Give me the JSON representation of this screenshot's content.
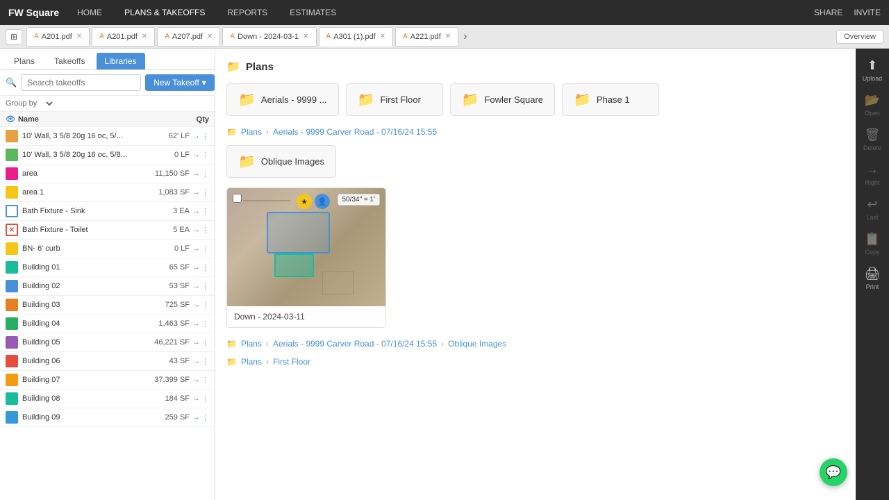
{
  "app": {
    "logo": "FW Square",
    "nav": [
      "HOME",
      "PLANS & TAKEOFFS",
      "REPORTS",
      "ESTIMATES"
    ],
    "active_nav": "PLANS & TAKEOFFS",
    "top_right": [
      "SHARE",
      "INVITE"
    ]
  },
  "tabs": [
    {
      "id": 1,
      "label": "A201.pdf",
      "closable": true
    },
    {
      "id": 2,
      "label": "A201.pdf",
      "closable": true
    },
    {
      "id": 3,
      "label": "A207.pdf",
      "closable": true
    },
    {
      "id": 4,
      "label": "Down - 2024-03-1",
      "closable": true
    },
    {
      "id": 5,
      "label": "A301 (1).pdf",
      "closable": true,
      "active": true
    },
    {
      "id": 6,
      "label": "A221.pdf",
      "closable": true
    }
  ],
  "tab_more": "›",
  "overview_label": "Overview",
  "sidebar": {
    "tabs": [
      "Plans",
      "Takeoffs",
      "Libraries"
    ],
    "active_tab": "Libraries",
    "search_placeholder": "Search takeoffs",
    "new_takeoff_label": "New Takeoff",
    "groupby_label": "Group by",
    "list_header": {
      "name": "Name",
      "qty": "Qty"
    },
    "items": [
      {
        "name": "10' Wall, 3 5/8 20g 16 oc, 5/...",
        "qty": "62' LF",
        "icon_color": "orange"
      },
      {
        "name": "10' Wall, 3 5/8 20g 16 oc, 5/8...",
        "qty": "0 LF",
        "icon_color": "green"
      },
      {
        "name": "area",
        "qty": "11,150 SF",
        "icon_color": "pink"
      },
      {
        "name": "area 1",
        "qty": "1,083 SF",
        "icon_color": "yellow"
      },
      {
        "name": "Bath Fixture - Sink",
        "qty": "3 EA",
        "icon_color": "blue_outline"
      },
      {
        "name": "Bath Fixture - Toilet",
        "qty": "5 EA",
        "icon_color": "red_x"
      },
      {
        "name": "BN- 6' curb",
        "qty": "0 LF",
        "icon_color": "yellow"
      },
      {
        "name": "Building 01",
        "qty": "65 SF",
        "icon_color": "teal"
      },
      {
        "name": "Building 02",
        "qty": "53 SF",
        "icon_color": "blue"
      },
      {
        "name": "Building 03",
        "qty": "725 SF",
        "icon_color": "orange2"
      },
      {
        "name": "Building 04",
        "qty": "1,463 SF",
        "icon_color": "green2"
      },
      {
        "name": "Building 05",
        "qty": "46,221 SF",
        "icon_color": "multi"
      },
      {
        "name": "Building 06",
        "qty": "43 SF",
        "icon_color": "multi2"
      },
      {
        "name": "Building 07",
        "qty": "37,399 SF",
        "icon_color": "multi3"
      },
      {
        "name": "Building 08",
        "qty": "184 SF",
        "icon_color": "multi4"
      },
      {
        "name": "Building 09",
        "qty": "259 SF",
        "icon_color": "multi5"
      }
    ]
  },
  "right_sidebar": {
    "buttons": [
      {
        "id": "upload",
        "label": "Upload",
        "icon": "⬆"
      },
      {
        "id": "open",
        "label": "Open",
        "icon": "📂"
      },
      {
        "id": "delete",
        "label": "Delete",
        "icon": "🗑"
      },
      {
        "id": "right",
        "label": "Right",
        "icon": "→"
      },
      {
        "id": "last",
        "label": "Last",
        "icon": "↩"
      },
      {
        "id": "copy",
        "label": "Copy",
        "icon": "📋"
      },
      {
        "id": "print",
        "label": "Print",
        "icon": "🖨"
      }
    ]
  },
  "content": {
    "plans_header": "Plans",
    "root_folders": [
      {
        "id": "aerials",
        "name": "Aerials - 9999 ...",
        "color": "#4a90d9"
      },
      {
        "id": "first_floor",
        "name": "First Floor",
        "color": "#4a90d9"
      },
      {
        "id": "fowler_square",
        "name": "Fowler Square",
        "color": "#4a90d9"
      },
      {
        "id": "phase1",
        "name": "Phase 1",
        "color": "#4a90d9"
      }
    ],
    "breadcrumb1": {
      "parts": [
        "Plans",
        "Aerials - 9999 Carver Road - 07/16/24 15:55"
      ],
      "icon": "📁"
    },
    "subfolder1": {
      "name": "Oblique Images",
      "color": "#4a90d9"
    },
    "plan_card": {
      "scale": "50/34\" = 1'",
      "label": "Down - 2024-03-11",
      "checkbox": false
    },
    "breadcrumb2": {
      "parts": [
        "Plans",
        "Aerials - 9999 Carver Road - 07/16/24 15:55",
        "Oblique Images"
      ],
      "icon": "📁"
    },
    "breadcrumb3": {
      "parts": [
        "Plans",
        "First Floor"
      ],
      "icon": "📁"
    }
  }
}
